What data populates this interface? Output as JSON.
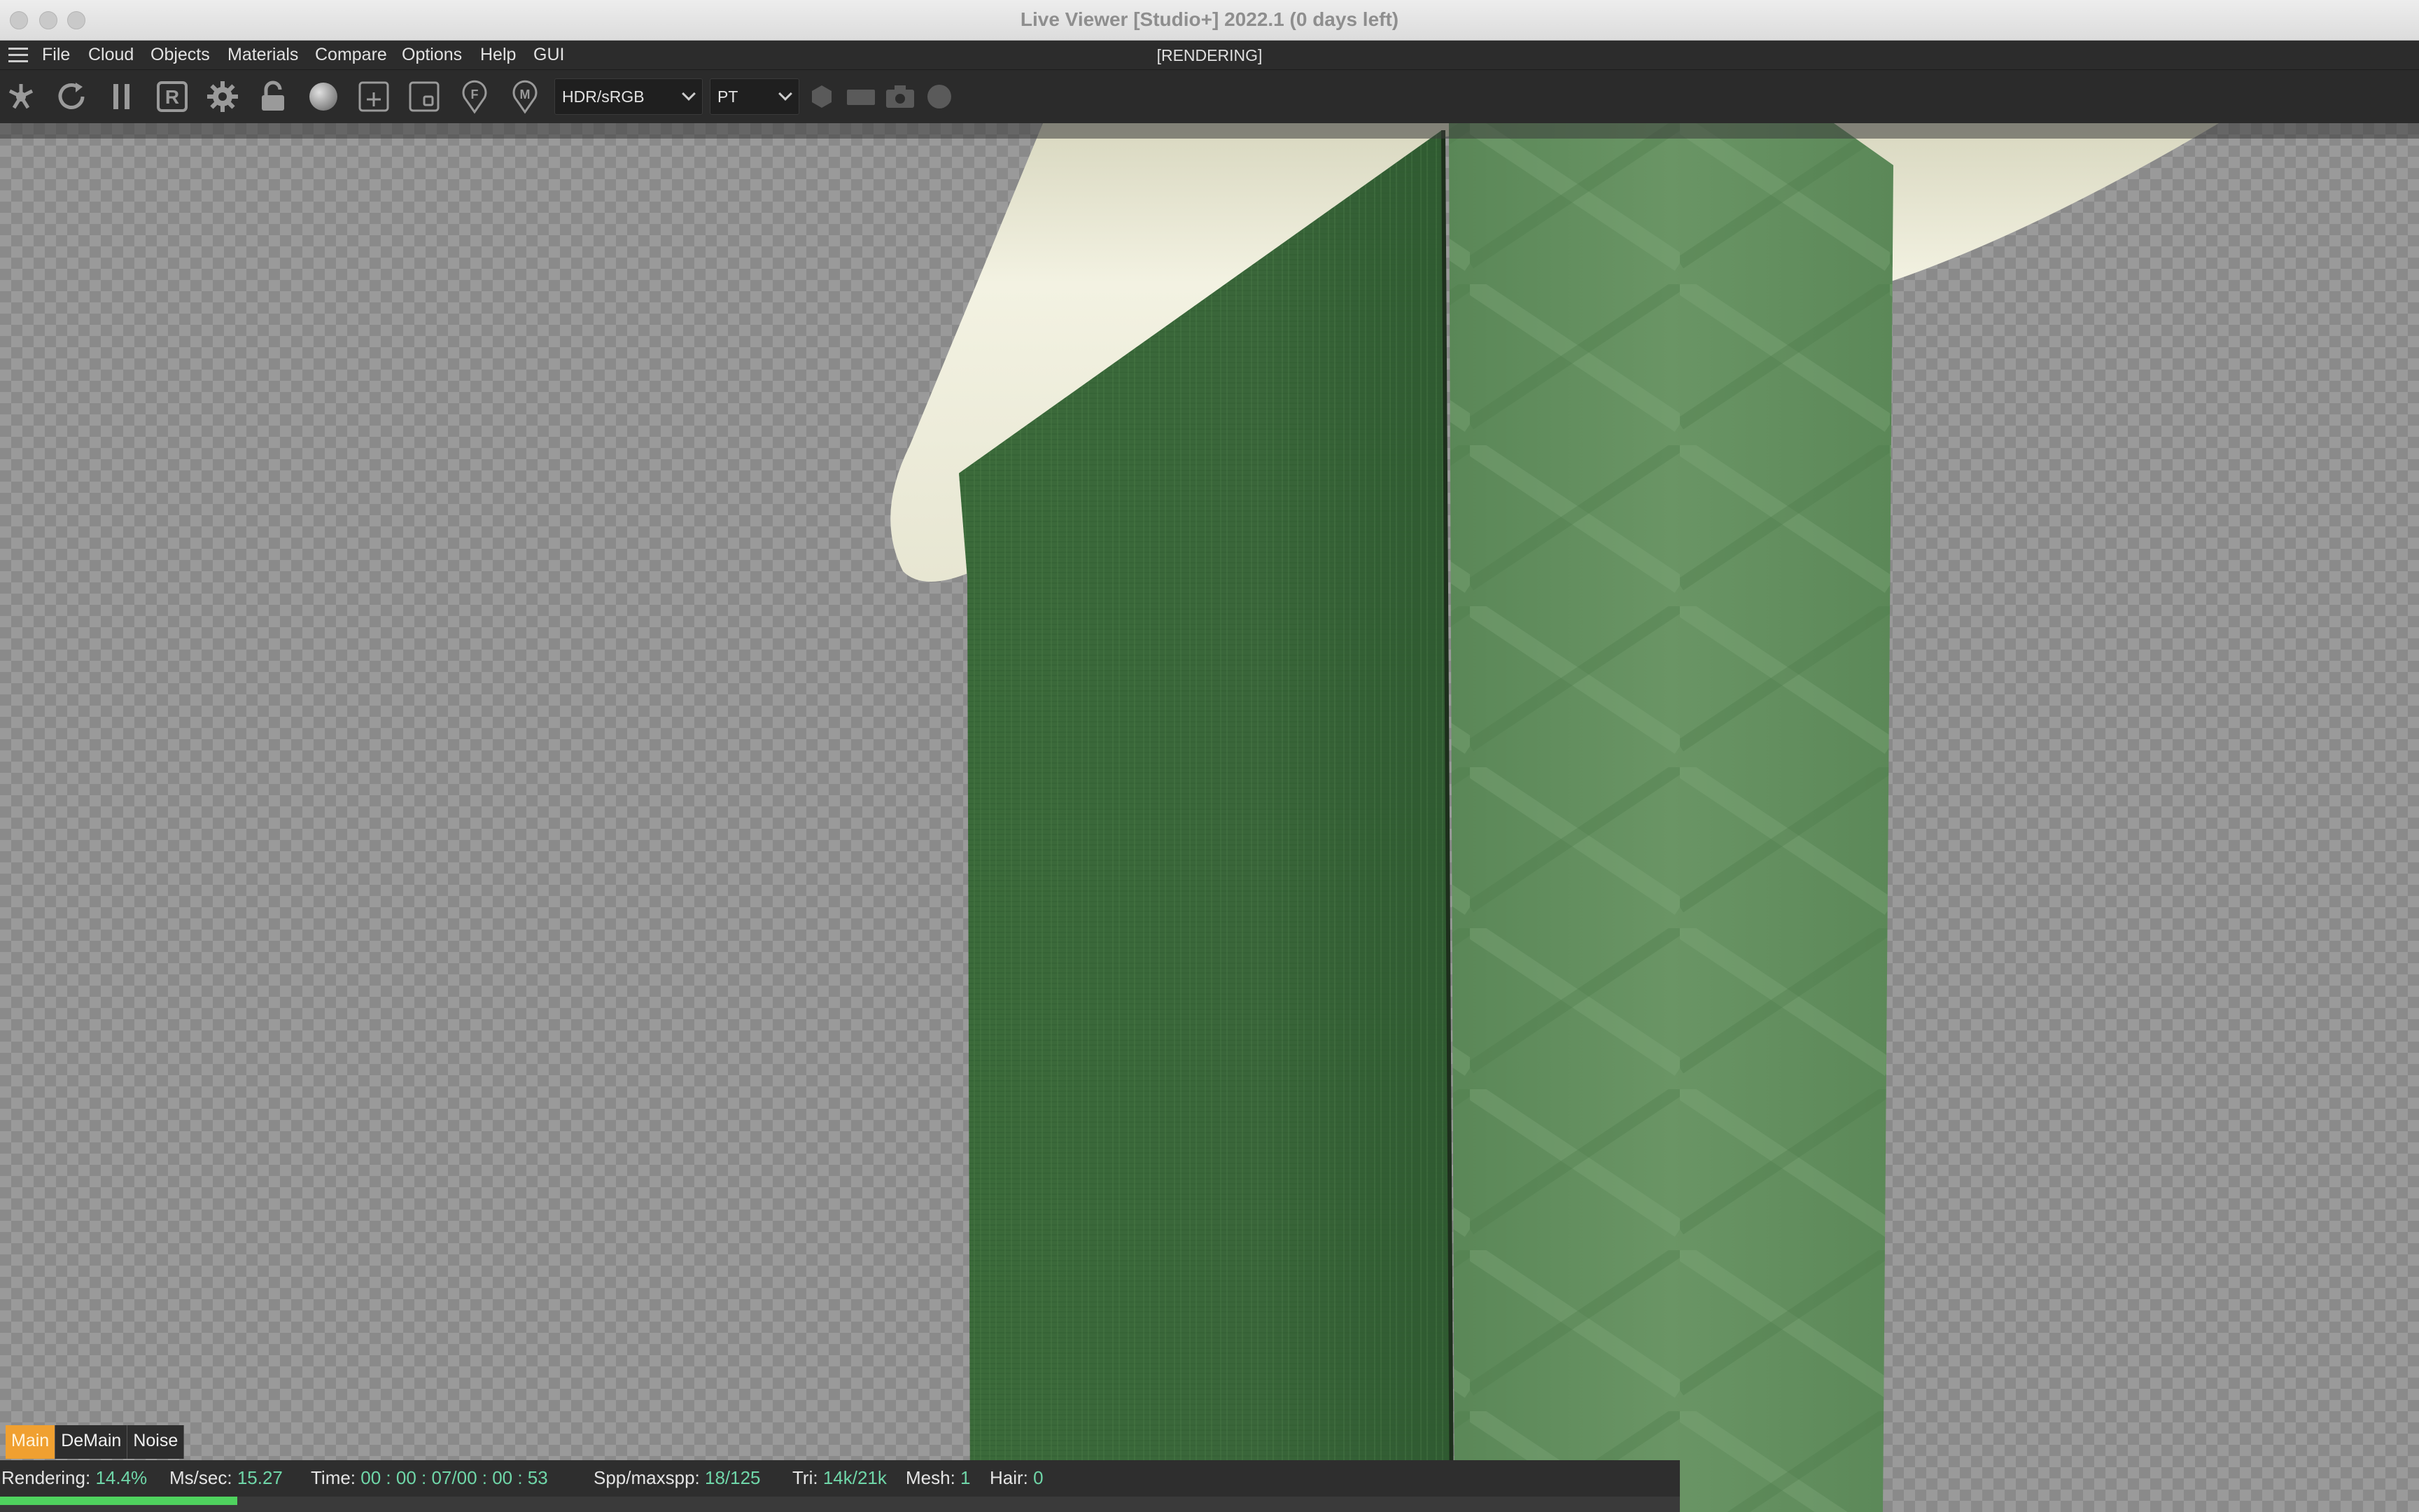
{
  "window": {
    "title": "Live Viewer [Studio+] 2022.1 (0 days left)",
    "render_status": "[RENDERING]"
  },
  "menu": {
    "items": [
      "File",
      "Cloud",
      "Objects",
      "Materials",
      "Compare",
      "Options",
      "Help",
      "GUI"
    ]
  },
  "toolbar": {
    "tools": [
      {
        "icon": "octane-logo-icon"
      },
      {
        "icon": "refresh-icon"
      },
      {
        "icon": "pause-icon"
      },
      {
        "icon": "render-region-icon",
        "letter": "R"
      },
      {
        "icon": "gear-icon"
      },
      {
        "icon": "unlock-icon"
      },
      {
        "icon": "material-sphere-icon"
      },
      {
        "icon": "add-region-icon"
      },
      {
        "icon": "film-region-icon"
      },
      {
        "icon": "focus-picker-icon",
        "letter": "F"
      },
      {
        "icon": "material-picker-icon",
        "letter": "M"
      }
    ],
    "color_space": "HDR/sRGB",
    "kernel": "PT",
    "right_icons": [
      "hexagon-icon",
      "rect-icon",
      "camera-icon",
      "circle-icon"
    ]
  },
  "passes": {
    "tabs": [
      "Main",
      "DeMain",
      "Noise"
    ],
    "active": "Main"
  },
  "status": {
    "rendering_label": "Rendering:",
    "rendering_value": "14.4%",
    "progress": 0.144,
    "ms_label": "Ms/sec:",
    "ms_value": "15.27",
    "time_label": "Time:",
    "time_value": "00 : 00 : 07/00 : 00 : 53",
    "spp_label": "Spp/maxspp:",
    "spp_value": "18/125",
    "tri_label": "Tri:",
    "tri_value": "14k/21k",
    "mesh_label": "Mesh:",
    "mesh_value": "1",
    "hair_label": "Hair:",
    "hair_value": "0"
  },
  "colors": {
    "accent_tab": "#f0a030",
    "progress": "#4fd25e",
    "status_value": "#6fd6a8",
    "leaf_dark": "#3f6b3e",
    "leaf_light": "#5f8a5b",
    "cream": "#efeedd"
  }
}
